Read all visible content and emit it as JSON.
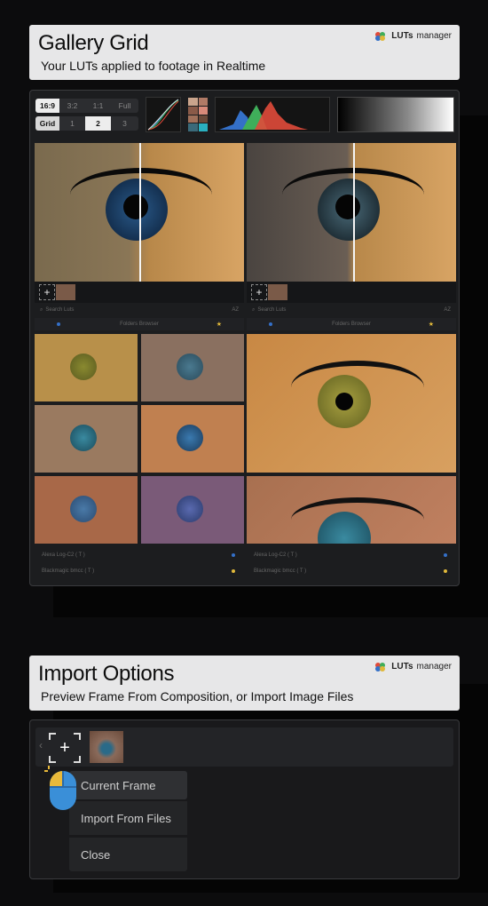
{
  "gallery_card": {
    "title": "Gallery Grid",
    "subtitle": "Your LUTs applied to footage in Realtime",
    "brand_bold": "LUTs",
    "brand_light": "manager"
  },
  "import_card": {
    "title": "Import Options",
    "subtitle": "Preview Frame From Composition, or Import Image Files",
    "brand_bold": "LUTs",
    "brand_light": "manager"
  },
  "toolbar": {
    "aspect_options": [
      "16:9",
      "3:2",
      "1:1",
      "Full"
    ],
    "aspect_selected": "16:9",
    "grid_label": "Grid",
    "grid_options": [
      "1",
      "2",
      "3"
    ],
    "grid_selected": "2"
  },
  "browser_left": {
    "search_placeholder": "Search Luts",
    "sort_label": "AZ",
    "folders_label": "Folders Browser",
    "list": [
      "Alexa Log-C2 ( T )",
      "Blackmagic bmcc ( T )"
    ]
  },
  "browser_right": {
    "search_placeholder": "Search Luts",
    "sort_label": "AZ",
    "folders_label": "Folders Browser",
    "list": [
      "Alexa Log-C2 ( T )",
      "Blackmagic bmcc ( T )"
    ]
  },
  "import_menu": {
    "items": [
      "Current Frame",
      "Import From Files",
      "Close"
    ]
  },
  "icons": {
    "add_frame": "plus-icon",
    "search": "search-icon",
    "star": "star-icon",
    "mouse": "mouse-icon"
  },
  "colors": {
    "accent_yellow": "#e8b93a",
    "accent_blue": "#3a8fd8",
    "brand_red": "#e04a3a",
    "brand_green": "#3fae5a",
    "brand_blue": "#3470c8"
  }
}
